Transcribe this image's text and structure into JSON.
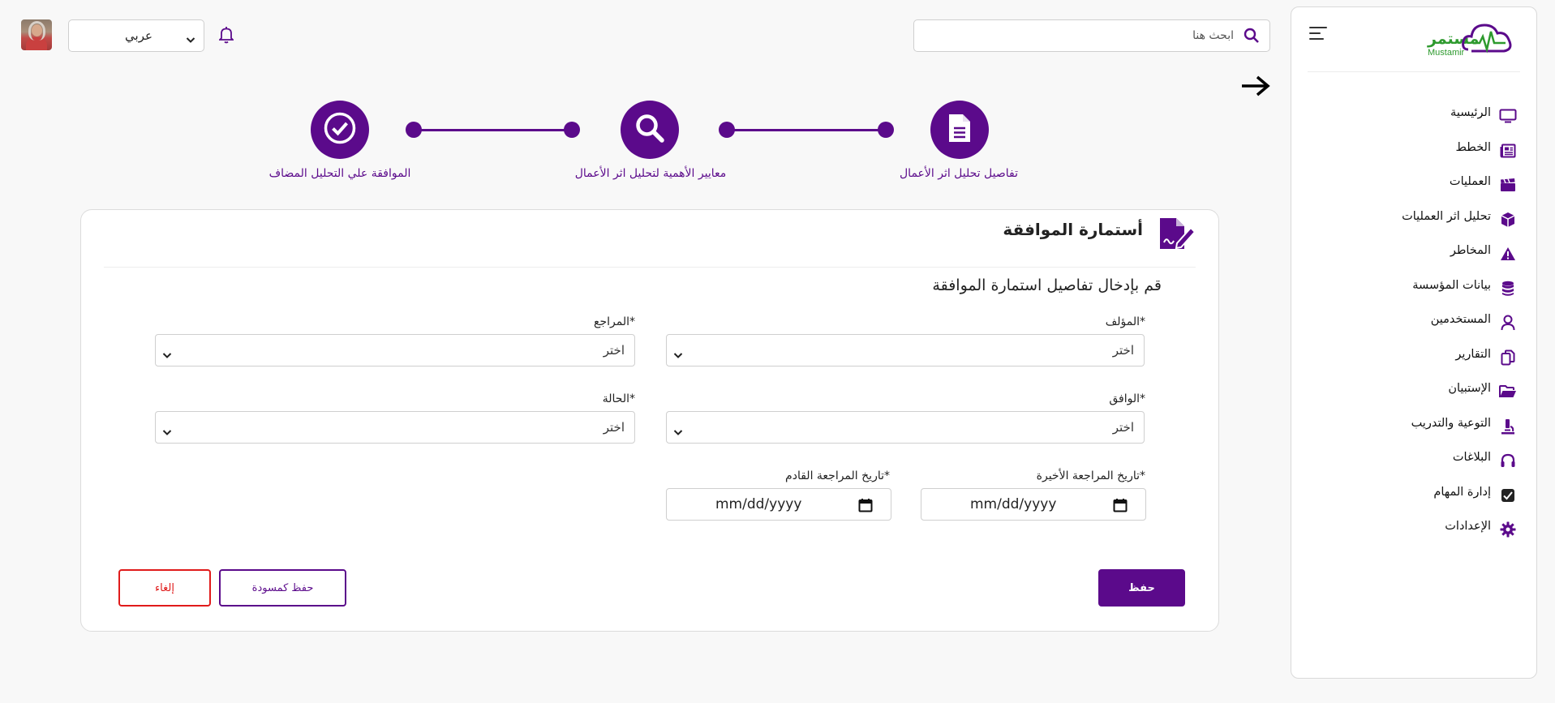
{
  "brand": {
    "name_ar": "مستمر",
    "name_en": "Mustamir",
    "primary_color": "#5b0a8b",
    "logo_color": "#2e9a2e"
  },
  "sidebar": {
    "items": [
      {
        "label": "الرئيسية",
        "icon": "monitor-icon"
      },
      {
        "label": "الخطط",
        "icon": "newspaper-icon"
      },
      {
        "label": "العمليات",
        "icon": "clapperboard-icon"
      },
      {
        "label": "تحليل اثر العمليات",
        "icon": "cube-icon"
      },
      {
        "label": "المخاطر",
        "icon": "warning-icon"
      },
      {
        "label": "بيانات المؤسسة",
        "icon": "database-icon"
      },
      {
        "label": "المستخدمين",
        "icon": "user-icon"
      },
      {
        "label": "التقارير",
        "icon": "copy-icon"
      },
      {
        "label": "الإستبيان",
        "icon": "folder-open-icon"
      },
      {
        "label": "التوعية والتدريب",
        "icon": "microscope-icon"
      },
      {
        "label": "البلاغات",
        "icon": "headset-icon"
      },
      {
        "label": "إدارة المهام",
        "icon": "tasks-icon"
      },
      {
        "label": "الإعدادات",
        "icon": "gear-icon"
      }
    ]
  },
  "header": {
    "search_placeholder": "ابحث هنا",
    "language": "عربي"
  },
  "stepper": {
    "steps": [
      {
        "label": "تفاصيل تحليل اثر الأعمال",
        "icon": "document-icon"
      },
      {
        "label": "معايير الأهمية لتحليل اثر الأعمال",
        "icon": "search-icon"
      },
      {
        "label": "الموافقة علي التحليل المضاف",
        "icon": "check-circle-icon"
      }
    ]
  },
  "form": {
    "title": "أستمارة الموافقة",
    "subtitle": "قم بإدخال تفاصيل استمارة الموافقة",
    "fields": {
      "author": {
        "label": "*المؤلف",
        "value": "اختر"
      },
      "reviewer": {
        "label": "*المراجع",
        "value": "اختر"
      },
      "approver": {
        "label": "*الوافق",
        "value": "اختر"
      },
      "status": {
        "label": "*الحالة",
        "value": "اختر"
      },
      "last_review": {
        "label": "*تاريخ المراجعة الأخيرة",
        "value": "mm/dd/yyyy"
      },
      "next_review": {
        "label": "*تاريخ المراجعة القادم",
        "value": "mm/dd/yyyy"
      }
    },
    "buttons": {
      "save": "حفظ",
      "save_draft": "حفظ كمسودة",
      "cancel": "إلغاء"
    }
  }
}
